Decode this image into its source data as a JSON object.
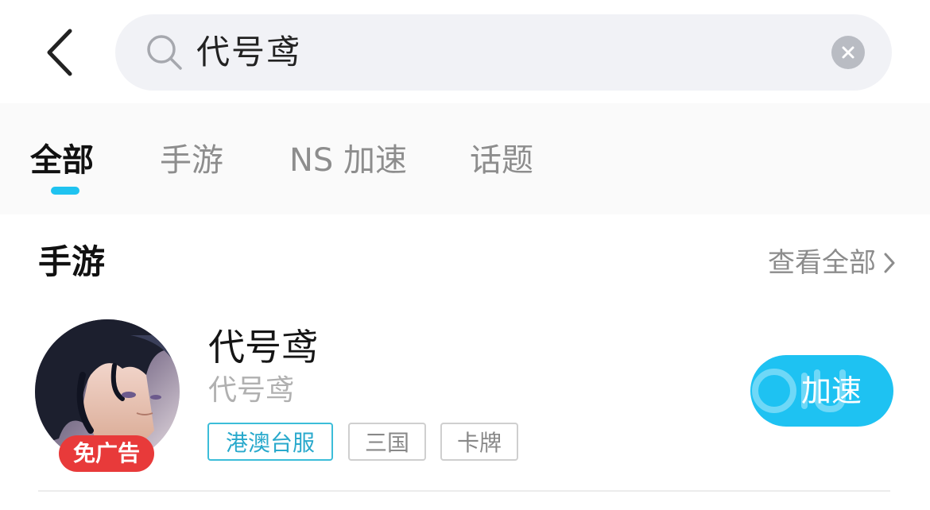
{
  "search": {
    "query": "代号鸢"
  },
  "tabs": [
    {
      "label": "全部",
      "active": true
    },
    {
      "label": "手游",
      "active": false
    },
    {
      "label": "NS 加速",
      "active": false
    },
    {
      "label": "话题",
      "active": false
    }
  ],
  "section": {
    "title": "手游",
    "view_all": "查看全部"
  },
  "game": {
    "name": "代号鸢",
    "subtitle": "代号鸢",
    "badge": "免广告",
    "tags": [
      "港澳台服",
      "三国",
      "卡牌"
    ],
    "action_label": "加速"
  },
  "colors": {
    "accent": "#1fc3f0",
    "badge_red": "#e83a3a",
    "tag_primary": "#29a9cc"
  },
  "icons": {
    "back": "chevron-left-icon",
    "search": "search-icon",
    "clear": "close-icon",
    "view_all_arrow": "chevron-right-icon"
  }
}
